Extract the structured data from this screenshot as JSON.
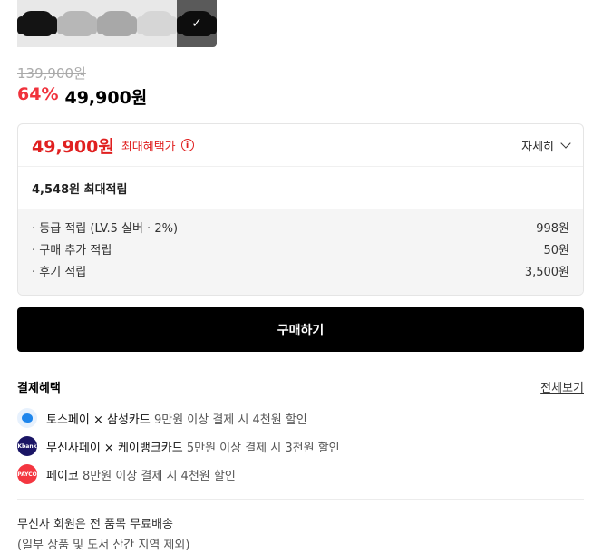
{
  "thumbnails": [
    {
      "color": "#141414",
      "selected": false
    },
    {
      "color": "#b7b7b7",
      "selected": false
    },
    {
      "color": "#a8a8a8",
      "selected": false
    },
    {
      "color": "#d6d6d6",
      "selected": false
    },
    {
      "color": "#0d0d0d",
      "selected": true
    }
  ],
  "check_glyph": "✓",
  "price": {
    "original": "139,900원",
    "discount": "64%",
    "sale": "49,900원"
  },
  "benefit": {
    "max_price": "49,900원",
    "max_label": "최대혜택가",
    "info_icon": "i",
    "detail_label": "자세히",
    "points_summary": "4,548원 최대적립",
    "items": [
      {
        "label": "· 등급 적립 (LV.5 실버 · 2%)",
        "value": "998원"
      },
      {
        "label": "· 구매 추가 적립",
        "value": "50원"
      },
      {
        "label": "· 후기 적립",
        "value": "3,500원"
      }
    ]
  },
  "buy_button": "구매하기",
  "payment": {
    "title": "결제혜택",
    "view_all": "전체보기",
    "items": [
      {
        "logo": "toss-logo",
        "logo_text": "",
        "name": "토스페이 × 삼성카드",
        "desc": " 9만원 이상 결제 시 4천원 할인"
      },
      {
        "logo": "kbank-logo",
        "logo_text": "Kbank",
        "name": "무신사페이 × 케이뱅크카드",
        "desc": " 5만원 이상 결제 시 3천원 할인"
      },
      {
        "logo": "payco-logo",
        "logo_text": "PAYCO",
        "name": "페이코",
        "desc": " 8만원 이상 결제 시 4천원 할인"
      }
    ]
  },
  "shipping": {
    "line1": "무신사 회원은 전 품목 무료배송",
    "line2": "(일부 상품 및 도서 산간 지역 제외)"
  },
  "colors": {
    "accent_red": "#f0323c",
    "benefit_red": "#e02020",
    "button_bg": "#000000"
  }
}
